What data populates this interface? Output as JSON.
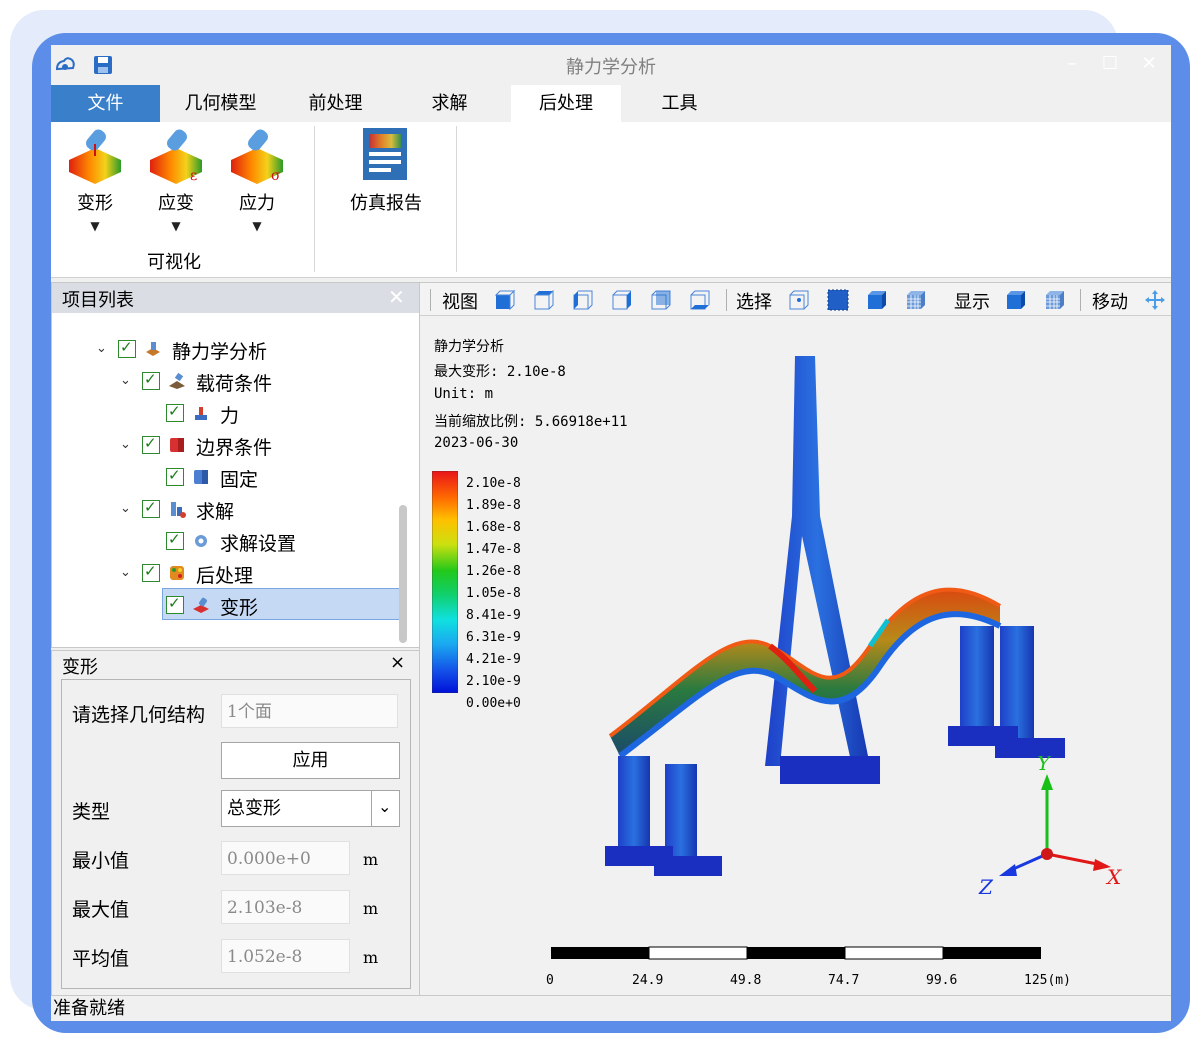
{
  "window": {
    "title": "静力学分析"
  },
  "tabs": [
    {
      "label": "文件"
    },
    {
      "label": "几何模型"
    },
    {
      "label": "前处理"
    },
    {
      "label": "求解"
    },
    {
      "label": "后处理"
    },
    {
      "label": "工具"
    }
  ],
  "ribbon": {
    "deform": "变形",
    "strain": "应变",
    "stress": "应力",
    "report": "仿真报告",
    "group_label": "可视化"
  },
  "project_panel": {
    "title": "项目列表",
    "tree": {
      "root": "静力学分析",
      "loads": "载荷条件",
      "force": "力",
      "bounds": "边界条件",
      "fixed": "固定",
      "solve": "求解",
      "solve_settings": "求解设置",
      "post": "后处理",
      "deform": "变形"
    }
  },
  "props_panel": {
    "title": "变形",
    "close": "×",
    "geometry_label": "请选择几何结构",
    "geometry_value": "1个面",
    "apply": "应用",
    "type_label": "类型",
    "type_value": "总变形",
    "min_label": "最小值",
    "min_value": "0.000e+0",
    "max_label": "最大值",
    "max_value": "2.103e-8",
    "avg_label": "平均值",
    "avg_value": "1.052e-8",
    "unit": "m"
  },
  "viewer": {
    "toolbar": {
      "view": "视图",
      "select": "选择",
      "display": "显示",
      "move": "移动"
    },
    "info": {
      "title": "静力学分析",
      "max_deform": "最大变形: 2.10e-8",
      "unit": "Unit: m",
      "scale": "当前缩放比例: 5.66918e+11",
      "date": "2023-06-30"
    },
    "legend": [
      "2.10e-8",
      "1.89e-8",
      "1.68e-8",
      "1.47e-8",
      "1.26e-8",
      "1.05e-8",
      "8.41e-9",
      "6.31e-9",
      "4.21e-9",
      "2.10e-9",
      "0.00e+0"
    ],
    "scale_bar": [
      "0",
      "24.9",
      "49.8",
      "74.7",
      "99.6",
      "125(m)"
    ],
    "axes": {
      "x": "X",
      "y": "Y",
      "z": "Z"
    }
  },
  "status": {
    "text": "准备就绪"
  }
}
